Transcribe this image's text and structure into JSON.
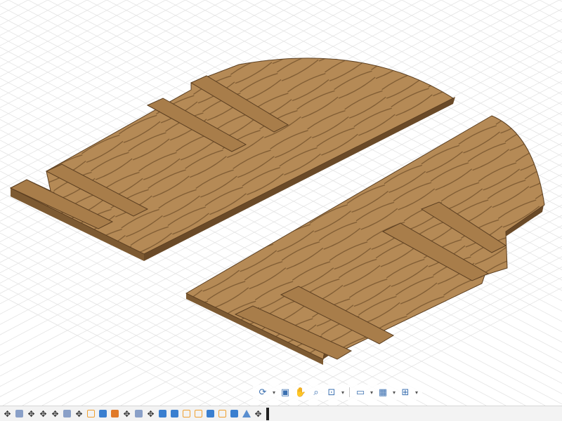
{
  "colors": {
    "wood_light": "#b58a56",
    "wood_dark": "#7d5a32",
    "wood_edge": "#6a4a28",
    "grid": "#e4e4e4",
    "toolbar_icon": "#3a6fb0"
  },
  "nav_toolbar": {
    "items": [
      {
        "icon": "orbit-icon",
        "glyph": "⟳"
      },
      {
        "icon": "pan-view-icon",
        "glyph": "▣"
      },
      {
        "icon": "hand-pan-icon",
        "glyph": "✋"
      },
      {
        "icon": "zoom-icon",
        "glyph": "🔍"
      },
      {
        "icon": "fit-icon",
        "glyph": "⊡"
      },
      {
        "icon": "display-settings-icon",
        "glyph": "▭"
      },
      {
        "icon": "grid-settings-icon",
        "glyph": "▦"
      },
      {
        "icon": "viewports-icon",
        "glyph": "⊞"
      }
    ]
  },
  "timeline": {
    "items": [
      "move-icon",
      "component-icon",
      "move-icon",
      "move-icon",
      "move-icon",
      "component-icon",
      "move-icon",
      "sketch-icon",
      "extrude-icon",
      "extrude-orange-icon",
      "move-icon",
      "component-icon",
      "move-icon",
      "extrude-icon",
      "extrude-icon",
      "sketch-icon",
      "sketch-icon",
      "extrude-icon",
      "sketch-icon",
      "extrude-icon",
      "mirror-icon",
      "move-icon"
    ]
  }
}
